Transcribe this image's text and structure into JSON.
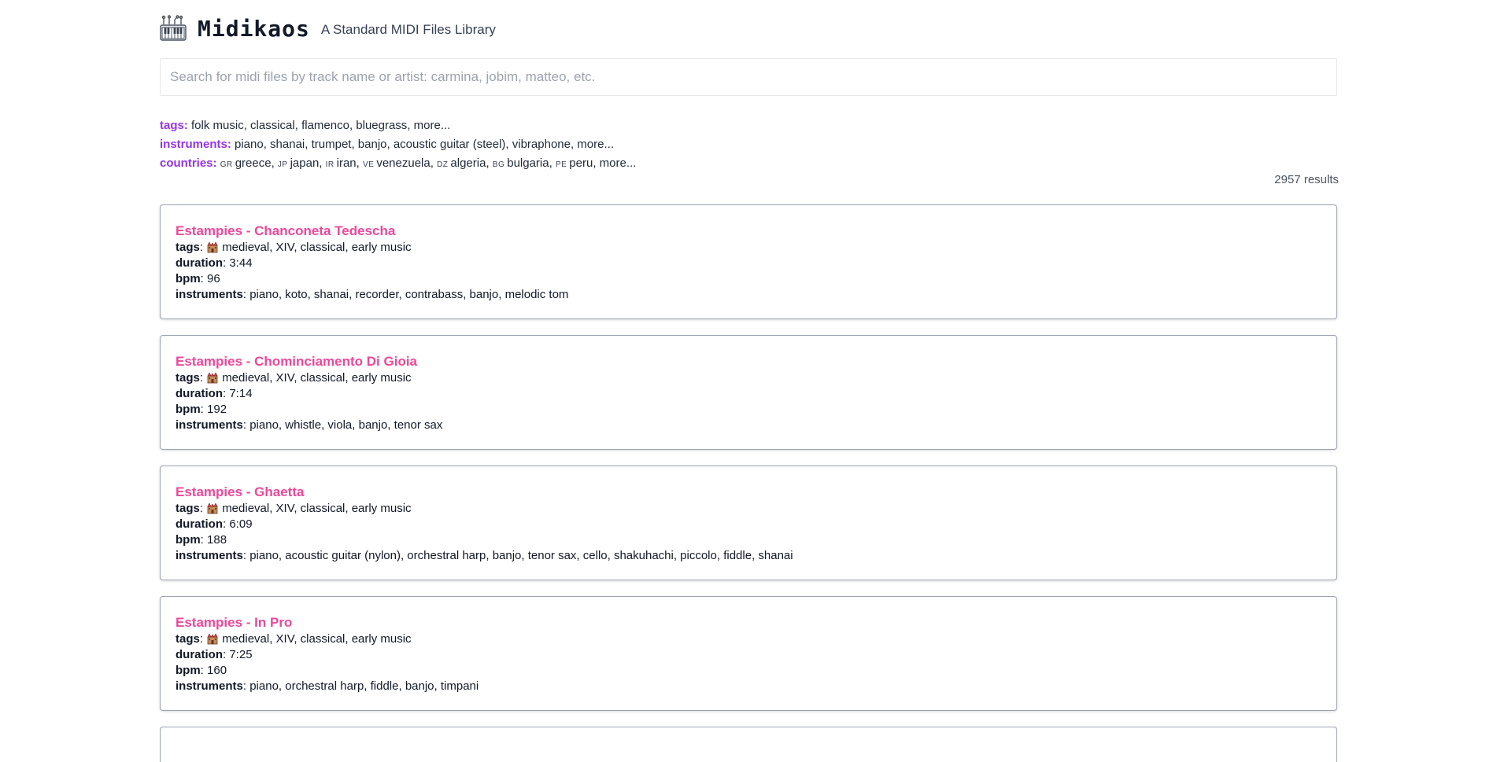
{
  "header": {
    "logo_icon": "keyboard-circuit-icon",
    "brand": "Midikaos",
    "tagline": "A Standard MIDI Files Library"
  },
  "search": {
    "placeholder": "Search for midi files by track name or artist: carmina, jobim, matteo, etc.",
    "value": ""
  },
  "filters": {
    "tags_label": "tags:",
    "tags": [
      " folk music",
      ", classical",
      ", flamenco",
      ", bluegrass",
      ", more..."
    ],
    "instruments_label": "instruments:",
    "instruments": [
      " piano",
      ", shanai",
      ", trumpet",
      ", banjo",
      ", acoustic guitar (steel)",
      ", vibraphone",
      ", more..."
    ],
    "countries_label": "countries:",
    "countries": [
      {
        "code": "GR",
        "name": "greece"
      },
      {
        "code": "JP",
        "name": "japan"
      },
      {
        "code": "IR",
        "name": "iran"
      },
      {
        "code": "VE",
        "name": "venezuela"
      },
      {
        "code": "DZ",
        "name": "algeria"
      },
      {
        "code": "BG",
        "name": "bulgaria"
      },
      {
        "code": "PE",
        "name": "peru"
      }
    ],
    "countries_more": "more..."
  },
  "results_count": "2957 results",
  "labels": {
    "tags": "tags",
    "duration": "duration",
    "bpm": "bpm",
    "instruments": "instruments"
  },
  "tracks": [
    {
      "title": "Estampies - Chanconeta Tedescha",
      "tag_icon": "castle-icon",
      "tags": "medieval, XIV, classical, early music",
      "duration": "3:44",
      "bpm": "96",
      "instruments": "piano, koto, shanai, recorder, contrabass, banjo, melodic tom"
    },
    {
      "title": "Estampies - Chominciamento Di Gioia",
      "tag_icon": "castle-icon",
      "tags": "medieval, XIV, classical, early music",
      "duration": "7:14",
      "bpm": "192",
      "instruments": "piano, whistle, viola, banjo, tenor sax"
    },
    {
      "title": "Estampies - Ghaetta",
      "tag_icon": "castle-icon",
      "tags": "medieval, XIV, classical, early music",
      "duration": "6:09",
      "bpm": "188",
      "instruments": "piano, acoustic guitar (nylon), orchestral harp, banjo, tenor sax, cello, shakuhachi, piccolo, fiddle, shanai"
    },
    {
      "title": "Estampies - In Pro",
      "tag_icon": "castle-icon",
      "tags": "medieval, XIV, classical, early music",
      "duration": "7:25",
      "bpm": "160",
      "instruments": "piano, orchestral harp, fiddle, banjo, timpani"
    }
  ],
  "colors": {
    "accent_purple": "#9333ea",
    "title_pink": "#ec4899",
    "card_border": "#9ca3af"
  }
}
